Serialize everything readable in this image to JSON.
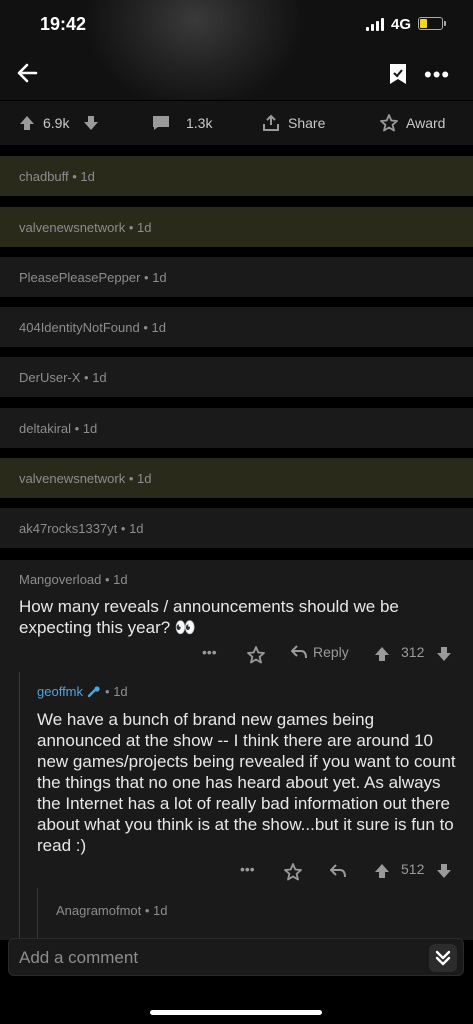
{
  "status_bar": {
    "time": "19:42",
    "network": "4G",
    "battery_percent": 35,
    "battery_color": "#f5d90a"
  },
  "nav": {
    "back_icon": "arrow-left-icon",
    "bookmark_icon": "bookmark-icon",
    "more_label": "•••"
  },
  "post_actions": {
    "upvotes": "6.9k",
    "comments": "1.3k",
    "share_label": "Share",
    "award_label": "Award"
  },
  "collapsed_comments": [
    {
      "user": "chadbuff",
      "age": "1d",
      "highlight": true
    },
    {
      "user": "valvenewsnetwork",
      "age": "1d",
      "highlight": true
    },
    {
      "user": "PleasePleasePepper",
      "age": "1d",
      "highlight": false
    },
    {
      "user": "404IdentityNotFound",
      "age": "1d",
      "highlight": false
    },
    {
      "user": "DerUser-X",
      "age": "1d",
      "highlight": false
    },
    {
      "user": "deltakiral",
      "age": "1d",
      "highlight": false
    },
    {
      "user": "valvenewsnetwork",
      "age": "1d",
      "highlight": true
    },
    {
      "user": "ak47rocks1337yt",
      "age": "1d",
      "highlight": false
    }
  ],
  "thread": {
    "comment1": {
      "user": "Mangoverload",
      "age": "1d",
      "body": "How many reveals / announcements should we be expecting this year? 👀",
      "more_label": "•••",
      "reply_label": "Reply",
      "votes": "312"
    },
    "comment2": {
      "user": "geoffmk",
      "age": "1d",
      "body": "We have a bunch of brand new games being announced at the show -- I think there are around 10 new games/projects being revealed if you want to count the things that no one has heard about yet. As always the Internet has a lot of really bad information out there about what you think is at the show...but it sure is fun to read :)",
      "more_label": "•••",
      "votes": "512"
    },
    "comment3": {
      "user": "Anagramofmot",
      "age": "1d"
    }
  },
  "composer": {
    "placeholder": "Add a comment"
  }
}
